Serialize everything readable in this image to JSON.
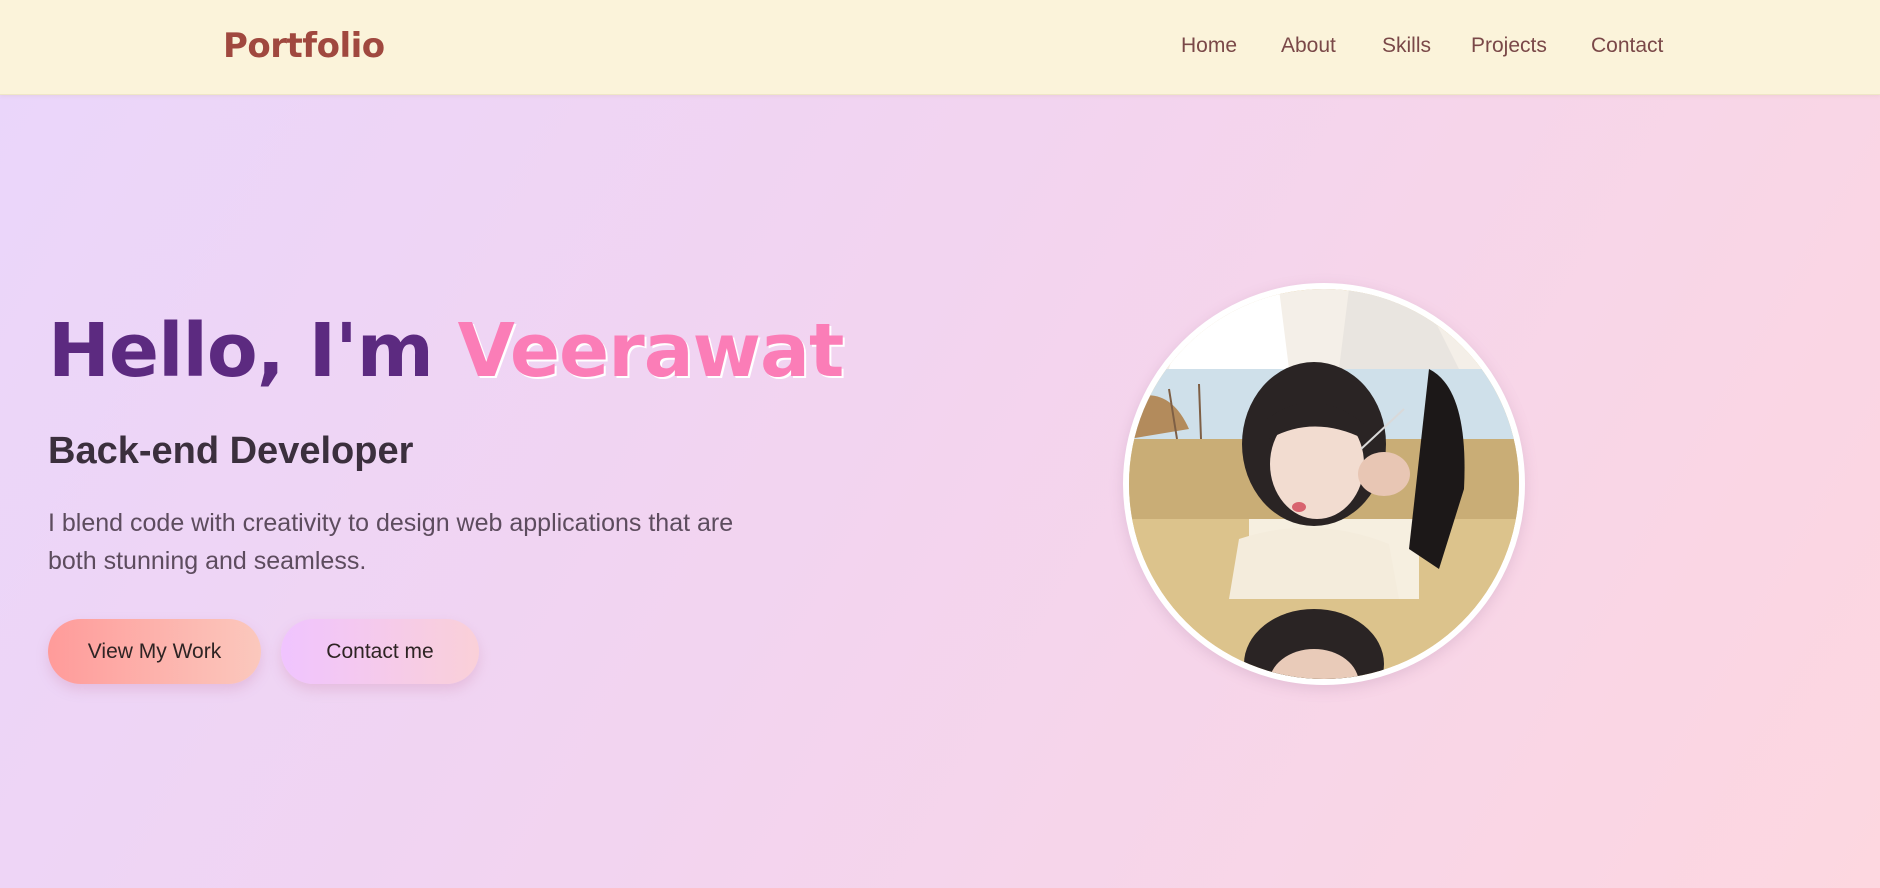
{
  "nav": {
    "logo": "Portfolio",
    "links": [
      "Home",
      "About",
      "Skills",
      "Projects",
      "Contact"
    ]
  },
  "hero": {
    "greeting": "Hello, I'm",
    "name": "Veerawat",
    "role": "Back-end Developer",
    "description": "I blend code with creativity to design web applications that are both stunning and seamless.",
    "buttons": {
      "primary": "View My Work",
      "secondary": "Contact me"
    }
  },
  "colors": {
    "nav_bg": "#fbf3da",
    "logo": "#a0483f",
    "greeting": "#5c2a80",
    "name_accent": "#fb7db7"
  }
}
